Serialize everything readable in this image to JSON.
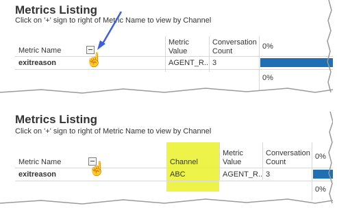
{
  "panel_top": {
    "title": "Metrics Listing",
    "instruction": "Click on '+' sign to right of Metric Name to view by Channel",
    "columns": {
      "metric_name": "Metric Name",
      "metric_value": "Metric\nValue",
      "conversation_count": "Conversation\nCount",
      "percent": "0%"
    },
    "row": {
      "metric_name": "exitreason",
      "metric_value": "AGENT_R..",
      "conversation_count": "3"
    },
    "footer_percent": "0%"
  },
  "panel_bottom": {
    "title": "Metrics Listing",
    "instruction": "Click on '+' sign to right of Metric Name to view by Channel",
    "columns": {
      "metric_name": "Metric Name",
      "channel": "Channel",
      "metric_value": "Metric\nValue",
      "conversation_count": "Conversation\nCount",
      "percent": "0%"
    },
    "row": {
      "metric_name": "exitreason",
      "channel": "ABC",
      "metric_value": "AGENT_R..",
      "conversation_count": "3"
    },
    "footer_percent": "0%"
  },
  "colors": {
    "bar": "#1f6fb2",
    "highlight": "#eef34a",
    "arrow": "#3b5fe0"
  },
  "icons": {
    "expand": "minus-box-icon",
    "pointer": "hand-pointer-icon",
    "arrow": "arrow-icon"
  }
}
